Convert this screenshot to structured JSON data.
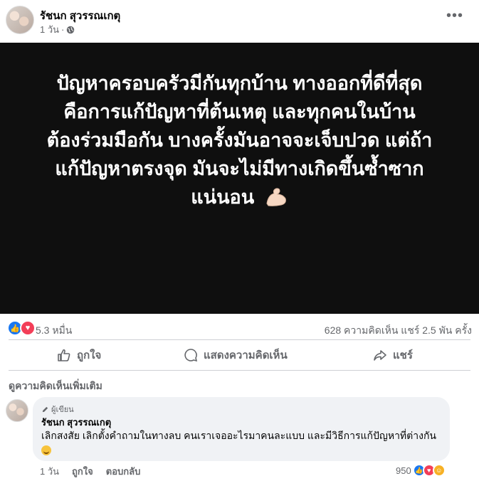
{
  "post": {
    "author": "รัชนก สุวรรณเกตุ",
    "time": "1 วัน",
    "privacy_icon": "globe-icon",
    "more_label": "•••",
    "image_text": [
      "ปัญหาครอบครัวมีกันทุกบ้าน ทางออกที่ดีที่สุด",
      "คือการแก้ปัญหาที่ต้นเหตุ และทุกคนในบ้าน",
      "ต้องร่วมมือกัน บางครั้งมันอาจจะเจ็บปวด แต่ถ้า",
      "แก้ปัญหาตรงจุด มันจะไม่มีทางเกิดขึ้นซ้ำซาก",
      "แน่นอน"
    ],
    "image_emoji": "flexed-biceps-icon",
    "reaction_count": "5.3 หมื่น",
    "comment_share_stats": "628 ความคิดเห็น  แชร์ 2.5 พัน ครั้ง"
  },
  "actions": {
    "like": "ถูกใจ",
    "comment": "แสดงความคิดเห็น",
    "share": "แชร์"
  },
  "comments_header": "ดูความคิดเห็นเพิ่มเติม",
  "comment": {
    "badge": "ผู้เขียน",
    "author": "รัชนก สุวรรณเกตุ",
    "text": "เลิกสงสัย เลิกตั้งคำถามในทางลบ คนเราเจออะไรมาคนละแบบ และมีวิธีการแก้ปัญหาที่ต่างกัน",
    "time": "1 วัน",
    "like_label": "ถูกใจ",
    "reply_label": "ตอบกลับ",
    "reaction_count": "950"
  },
  "colors": {
    "like": "#1877f2",
    "love": "#f33e58",
    "image_bg": "#0f0f0f",
    "secondary_text": "#65676b"
  }
}
